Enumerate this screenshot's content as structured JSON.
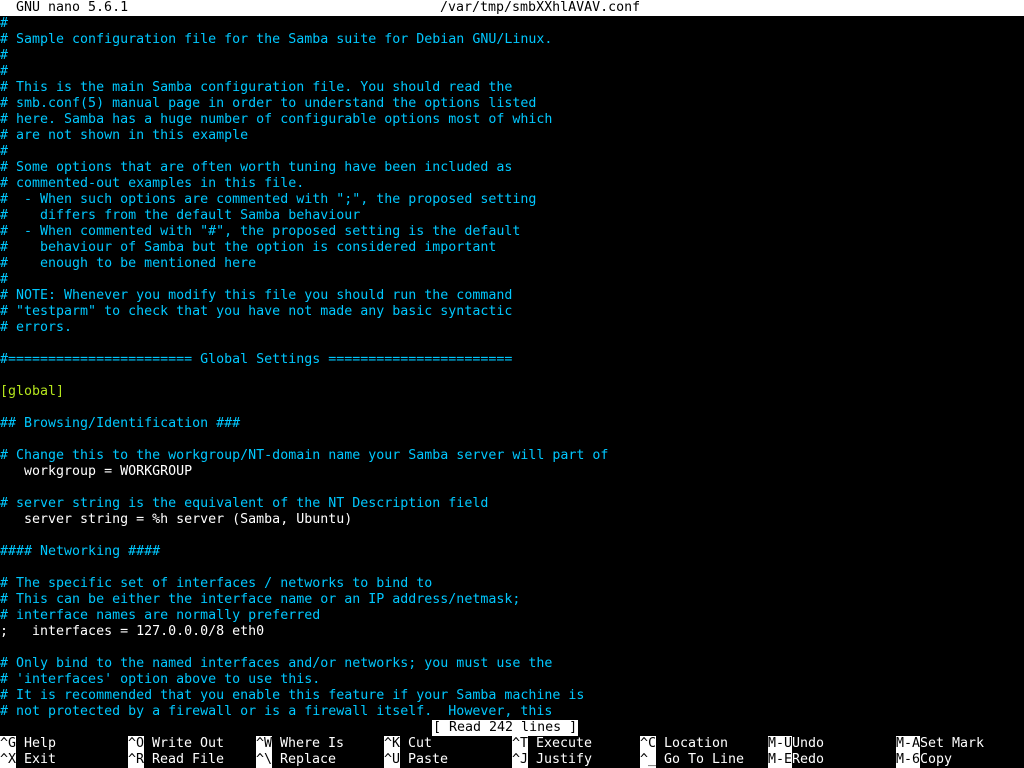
{
  "title": {
    "app": "GNU nano 5.6.1",
    "file": "/var/tmp/smbXXhlAVAV.conf"
  },
  "editor": {
    "lines": [
      {
        "text": "#",
        "kind": "comment"
      },
      {
        "text": "# Sample configuration file for the Samba suite for Debian GNU/Linux.",
        "kind": "comment"
      },
      {
        "text": "#",
        "kind": "comment"
      },
      {
        "text": "#",
        "kind": "comment"
      },
      {
        "text": "# This is the main Samba configuration file. You should read the",
        "kind": "comment"
      },
      {
        "text": "# smb.conf(5) manual page in order to understand the options listed",
        "kind": "comment"
      },
      {
        "text": "# here. Samba has a huge number of configurable options most of which",
        "kind": "comment"
      },
      {
        "text": "# are not shown in this example",
        "kind": "comment"
      },
      {
        "text": "#",
        "kind": "comment"
      },
      {
        "text": "# Some options that are often worth tuning have been included as",
        "kind": "comment"
      },
      {
        "text": "# commented-out examples in this file.",
        "kind": "comment"
      },
      {
        "text": "#  - When such options are commented with \";\", the proposed setting",
        "kind": "comment"
      },
      {
        "text": "#    differs from the default Samba behaviour",
        "kind": "comment"
      },
      {
        "text": "#  - When commented with \"#\", the proposed setting is the default",
        "kind": "comment"
      },
      {
        "text": "#    behaviour of Samba but the option is considered important",
        "kind": "comment"
      },
      {
        "text": "#    enough to be mentioned here",
        "kind": "comment"
      },
      {
        "text": "#",
        "kind": "comment"
      },
      {
        "text": "# NOTE: Whenever you modify this file you should run the command",
        "kind": "comment"
      },
      {
        "text": "# \"testparm\" to check that you have not made any basic syntactic",
        "kind": "comment"
      },
      {
        "text": "# errors.",
        "kind": "comment"
      },
      {
        "text": "",
        "kind": "plain"
      },
      {
        "text": "#======================= Global Settings =======================",
        "kind": "comment"
      },
      {
        "text": "",
        "kind": "plain"
      },
      {
        "text": "[global]",
        "kind": "section"
      },
      {
        "text": "",
        "kind": "plain"
      },
      {
        "text": "## Browsing/Identification ###",
        "kind": "comment"
      },
      {
        "text": "",
        "kind": "plain"
      },
      {
        "text": "# Change this to the workgroup/NT-domain name your Samba server will part of",
        "kind": "comment"
      },
      {
        "text": "   workgroup = WORKGROUP",
        "kind": "plain"
      },
      {
        "text": "",
        "kind": "plain"
      },
      {
        "text": "# server string is the equivalent of the NT Description field",
        "kind": "comment"
      },
      {
        "text": "   server string = %h server (Samba, Ubuntu)",
        "kind": "plain"
      },
      {
        "text": "",
        "kind": "plain"
      },
      {
        "text": "#### Networking ####",
        "kind": "comment"
      },
      {
        "text": "",
        "kind": "plain"
      },
      {
        "text": "# The specific set of interfaces / networks to bind to",
        "kind": "comment"
      },
      {
        "text": "# This can be either the interface name or an IP address/netmask;",
        "kind": "comment"
      },
      {
        "text": "# interface names are normally preferred",
        "kind": "comment"
      },
      {
        "text": ";   interfaces = 127.0.0.0/8 eth0",
        "kind": "plain"
      },
      {
        "text": "",
        "kind": "plain"
      },
      {
        "text": "# Only bind to the named interfaces and/or networks; you must use the",
        "kind": "comment"
      },
      {
        "text": "# 'interfaces' option above to use this.",
        "kind": "comment"
      },
      {
        "text": "# It is recommended that you enable this feature if your Samba machine is",
        "kind": "comment"
      },
      {
        "text": "# not protected by a firewall or is a firewall itself.  However, this",
        "kind": "comment"
      }
    ]
  },
  "status": {
    "message": "[ Read 242 lines ]"
  },
  "shortcuts": [
    {
      "key": "^G",
      "label": "Help"
    },
    {
      "key": "^O",
      "label": "Write Out"
    },
    {
      "key": "^W",
      "label": "Where Is"
    },
    {
      "key": "^K",
      "label": "Cut"
    },
    {
      "key": "^T",
      "label": "Execute"
    },
    {
      "key": "^C",
      "label": "Location"
    },
    {
      "key": "M-U",
      "label": "Undo"
    },
    {
      "key": "M-A",
      "label": "Set Mark"
    },
    {
      "key": "^X",
      "label": "Exit"
    },
    {
      "key": "^R",
      "label": "Read File"
    },
    {
      "key": "^\\",
      "label": "Replace"
    },
    {
      "key": "^U",
      "label": "Paste"
    },
    {
      "key": "^J",
      "label": "Justify"
    },
    {
      "key": "^_",
      "label": "Go To Line"
    },
    {
      "key": "M-E",
      "label": "Redo"
    },
    {
      "key": "M-6",
      "label": "Copy"
    }
  ],
  "colors": {
    "comment": "#00c8ff",
    "section": "#b5e61d",
    "text": "#ffffff",
    "background": "#000000",
    "inverse_bg": "#ffffff",
    "inverse_fg": "#000000"
  }
}
